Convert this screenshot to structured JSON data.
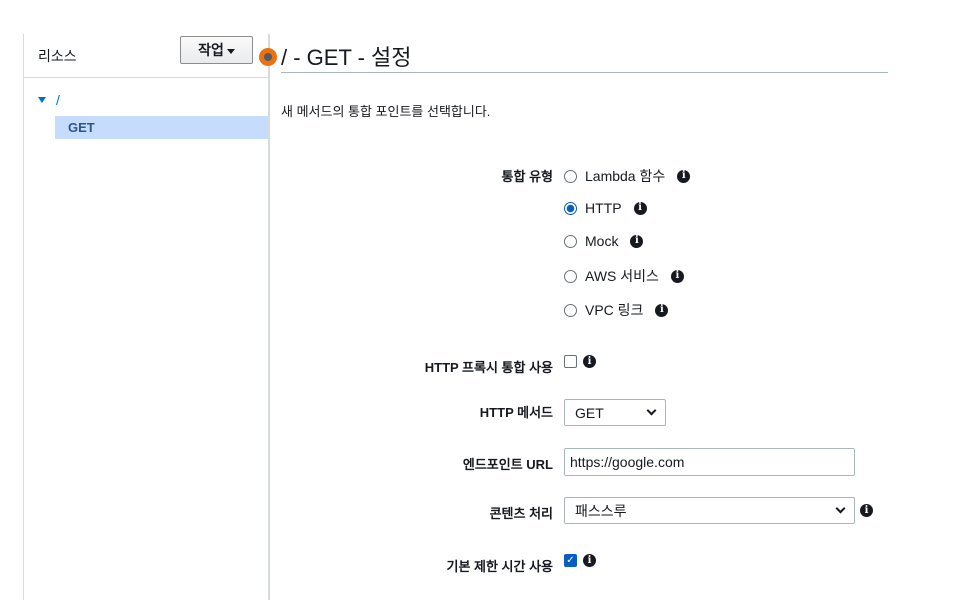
{
  "resources_panel": {
    "title": "리소스",
    "actions_label": "작업",
    "tree": {
      "root": "/",
      "selected_method": "GET"
    }
  },
  "method_setup": {
    "title": "/ - GET - 설정",
    "description": "새 메서드의 통합 포인트를 선택합니다.",
    "integration_type": {
      "label": "통합 유형",
      "options": [
        {
          "label": "Lambda 함수",
          "selected": false
        },
        {
          "label": "HTTP",
          "selected": true
        },
        {
          "label": "Mock",
          "selected": false
        },
        {
          "label": "AWS 서비스",
          "selected": false
        },
        {
          "label": "VPC 링크",
          "selected": false
        }
      ]
    },
    "http_proxy": {
      "label": "HTTP 프록시 통합 사용",
      "checked": false
    },
    "http_method": {
      "label": "HTTP 메서드",
      "value": "GET"
    },
    "endpoint_url": {
      "label": "엔드포인트 URL",
      "value": "https://google.com"
    },
    "content_handling": {
      "label": "콘텐츠 처리",
      "value": "패스스루"
    },
    "default_timeout": {
      "label": "기본 제한 시간 사용",
      "checked": true
    }
  },
  "icons": {
    "info": "info-icon",
    "caret": "caret-down-icon",
    "chevron": "chevron-down-icon"
  },
  "colors": {
    "accent": "#0a5dc2",
    "handle": "#ec7211",
    "selection": "#c6dcff",
    "link": "#0073bb"
  }
}
